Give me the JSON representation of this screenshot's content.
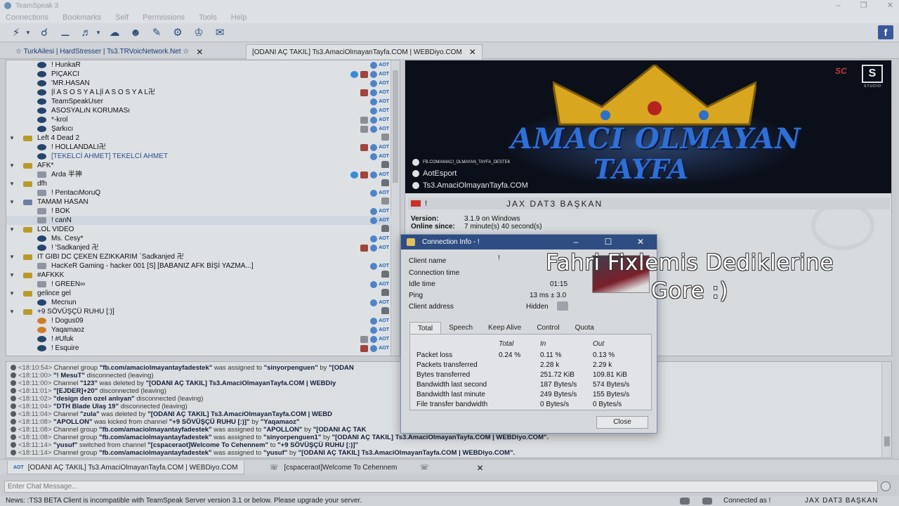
{
  "window": {
    "title": "TeamSpeak 3"
  },
  "menu": [
    "Connections",
    "Bookmarks",
    "Self",
    "Permissions",
    "Tools",
    "Help"
  ],
  "toolbar": {
    "facebook": "f"
  },
  "server_tabs": [
    {
      "label": "☆ TurkAilesi | HardStresser | Ts3.TRVoicNetwork.Net ☆"
    },
    {
      "label": "[ODANI AÇ TAKIL] Ts3.AmaciOlmayanTayfa.COM | WEBDiyo.COM"
    }
  ],
  "aot": "AOT",
  "tree": {
    "rows": [
      {
        "text": "!                     HunkaR"
      },
      {
        "text": "PIÇAKCI"
      },
      {
        "text": "'MR.HASAN"
      },
      {
        "text": "|İ      A S O S Y A L|İ      A S O S Y A L卍"
      },
      {
        "text": "TeamSpeakUser"
      },
      {
        "text": "ASOSYALıN KORUMASı"
      },
      {
        "text": "*-krol"
      },
      {
        "text": "Şarkıcı"
      },
      {
        "text": "Left 4 Dead 2"
      },
      {
        "text": "!                  HOLLANDALI卍"
      },
      {
        "text": "[TEKELCİ AHMET] TEKELCİ AHMET"
      },
      {
        "text": "AFK*"
      },
      {
        "text": "Arda 半神"
      },
      {
        "text": "dfh"
      },
      {
        "text": "!                   PentacıMoruQ"
      },
      {
        "text": "TAMAM HASAN"
      },
      {
        "text": "!                          BOK"
      },
      {
        "text": "!                         canN"
      },
      {
        "text": "LOL  VIDEO"
      },
      {
        "text": "Ms. Cesy*"
      },
      {
        "text": "!                          'Sadkanjed 卍"
      },
      {
        "text": "IT GIBI DC ÇEKEN EZIKKARIM `Sadkanjed 卍"
      },
      {
        "text": "HacKeR Gaming - hacker 001 [S] [BABANIZ AFK BİŞİ YAZMA...]"
      },
      {
        "text": "#AFKKK"
      },
      {
        "text": "!                    GREEN∞"
      },
      {
        "text": "gelince gel"
      },
      {
        "text": "Mecnun"
      },
      {
        "text": "+9 SÖVÜŞÇÜ RUHU [:)]"
      },
      {
        "text": "!                    Dogus09"
      },
      {
        "text": "Yaqamaoz"
      },
      {
        "text": "!                 #Ufuk"
      },
      {
        "text": "!                 Esquire"
      }
    ]
  },
  "banner": {
    "title1": "AMACI OLMAYAN",
    "title2": "TAYFA",
    "link1": "FB.COM/AMACI_OLMAYAN_TAYFA_DESTEK",
    "link2": "AotEsport",
    "link3": "Ts3.AmaciOlmayanTayfa.COM",
    "brand": "S",
    "brand_small": "SC",
    "brand_caption": "STUDIO"
  },
  "client": {
    "mark": "!",
    "name": "JAX DAT3 BAŞKAN",
    "version_label": "Version:",
    "version_value": "3.1.9 on Windows",
    "online_label": "Online since:",
    "online_value": "7 minute(s) 40 second(s)"
  },
  "chat_lines": [
    {
      "time": "<18:10:54>",
      "pre": " Channel group ",
      "a": "\"fb.com/amaciolmayantayfadestek\"",
      "mid": " was assigned to ",
      "b": "\"sinyorpenguen\"",
      "post": " by ",
      "c": "\"[ODAN"
    },
    {
      "time": "<18:11:00>",
      "pre": " ",
      "a": "\"!               MesuT\"",
      "mid": " disconnected (leaving)",
      "b": "",
      "post": "",
      "c": ""
    },
    {
      "time": "<18:11:00>",
      "pre": " Channel ",
      "a": "\"123\"",
      "mid": " was deleted by ",
      "b": "\"[ODANI AÇ TAKIL] Ts3.AmaciOlmayanTayfa.COM | WEBDiy",
      "post": "",
      "c": ""
    },
    {
      "time": "<18:11:01>",
      "pre": " ",
      "a": "\"[EJDER]+20\"",
      "mid": " disconnected (leaving)",
      "b": "",
      "post": "",
      "c": ""
    },
    {
      "time": "<18:11:02>",
      "pre": " ",
      "a": "\"design den ozel anlıyan\"",
      "mid": " disconnected (leaving)",
      "b": "",
      "post": "",
      "c": ""
    },
    {
      "time": "<18:11:04>",
      "pre": " ",
      "a": "\"DTH Blade Ulaş 19\"",
      "mid": " disconnected (leaving)",
      "b": "",
      "post": "",
      "c": ""
    },
    {
      "time": "<18:11:04>",
      "pre": " Channel ",
      "a": "\"zula\"",
      "mid": " was deleted by ",
      "b": "\"[ODANI AÇ TAKIL] Ts3.AmaciOlmayanTayfa.COM | WEBD",
      "post": "",
      "c": ""
    },
    {
      "time": "<18:11:08>",
      "pre": " ",
      "a": "\"APOLLON\"",
      "mid": " was kicked from channel ",
      "b": "\"+9 SÖVÜŞÇÜ RUHU [:)]\"",
      "post": " by ",
      "c": "\"Yaqamaoz\""
    },
    {
      "time": "<18:11:08>",
      "pre": " Channel group ",
      "a": "\"fb.com/amaciolmayantayfadestek\"",
      "mid": " was assigned to ",
      "b": "\"APOLLON\"",
      "post": " by ",
      "c": "\"[ODANI AÇ TAK"
    },
    {
      "time": "<18:11:08>",
      "pre": " Channel group ",
      "a": "\"fb.com/amaciolmayantayfadestek\"",
      "mid": " was assigned to ",
      "b": "\"sinyorpenguen1\"",
      "post": " by ",
      "c": "\"[ODANI AÇ TAKIL] Ts3.AmaciOlmayanTayfa.COM | WEBDiyo.COM\"."
    },
    {
      "time": "<18:11:14>",
      "pre": " ",
      "a": "\"yusuf\"",
      "mid": " switched from channel ",
      "b": "\"[cspaceraot]Welcome To Cehennem\"",
      "post": " to ",
      "c": "\"+9 SÖVÜŞÇÜ RUHU [:)]\""
    },
    {
      "time": "<18:11:14>",
      "pre": " Channel group ",
      "a": "\"fb.com/amaciolmayantayfadestek\"",
      "mid": " was assigned to ",
      "b": "\"yusuf\"",
      "post": " by ",
      "c": "\"[ODANI AÇ TAKIL] Ts3.AmaciOlmayanTayfa.COM | WEBDiyo.COM\"."
    }
  ],
  "chat_tabs": [
    {
      "label": "[ODANI AÇ TAKIL] Ts3.AmaciOlmayanTayfa.COM | WEBDiyo.COM"
    },
    {
      "label": "[cspaceraot]Welcome To Cehennem"
    },
    {
      "label": ""
    }
  ],
  "chat_input": {
    "placeholder": "Enter Chat Message..."
  },
  "status": {
    "news": "News: :TS3 BETA Client is incompatible with TeamSpeak Server version 3.1 or below. Please upgrade your server.",
    "connected": "Connected as !",
    "who": "JAX DAT3 BAŞKAN"
  },
  "dialog": {
    "title": "Connection Info - !",
    "fields": [
      {
        "label": "Client name",
        "value": "!"
      },
      {
        "label": "Connection time",
        "value": ""
      },
      {
        "label": "Idle time",
        "value": "01:15"
      },
      {
        "label": "Ping",
        "value": "13 ms ± 3.0"
      },
      {
        "label": "Client address",
        "value": "Hidden"
      }
    ],
    "tabs": [
      "Total",
      "Speech",
      "Keep Alive",
      "Control",
      "Quota"
    ],
    "headers": {
      "total": "Total",
      "in": "In",
      "out": "Out"
    },
    "stats": [
      {
        "label": "Packet loss",
        "total": "0.24 %",
        "in": "0.11 %",
        "out": "0.13 %"
      },
      {
        "label": "Packets transferred",
        "total": "",
        "in": "2.28 k",
        "out": "2.29 k"
      },
      {
        "label": "Bytes transferred",
        "total": "",
        "in": "251.72 KiB",
        "out": "109.81 KiB"
      },
      {
        "label": "Bandwidth last second",
        "total": "",
        "in": "187 Bytes/s",
        "out": "574 Bytes/s"
      },
      {
        "label": "Bandwidth last minute",
        "total": "",
        "in": "249 Bytes/s",
        "out": "155 Bytes/s"
      },
      {
        "label": "File transfer bandwidth",
        "total": "",
        "in": "0 Bytes/s",
        "out": "0 Bytes/s"
      }
    ],
    "close": "Close"
  },
  "caption": {
    "line1": "Fahri Fixlemis Dediklerine",
    "line2": "Gore :)"
  }
}
